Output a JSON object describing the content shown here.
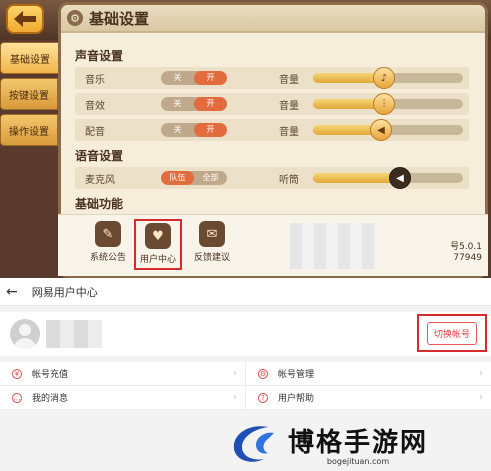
{
  "game": {
    "panel_title": "基础设置",
    "tabs": [
      "基础设置",
      "按键设置",
      "操作设置"
    ],
    "sections": {
      "sound": "声音设置",
      "voice": "语音设置",
      "basic": "基础功能"
    },
    "sound_rows": [
      {
        "label": "音乐",
        "off": "关",
        "on": "开",
        "vol_label": "音量",
        "level": 0.47,
        "icon": "music-note-icon"
      },
      {
        "label": "音效",
        "off": "关",
        "on": "开",
        "vol_label": "音量",
        "level": 0.47,
        "icon": "equalizer-icon"
      },
      {
        "label": "配音",
        "off": "关",
        "on": "开",
        "vol_label": "音量",
        "level": 0.45,
        "icon": "speaker-icon"
      }
    ],
    "voice_row": {
      "label": "麦克风",
      "opt1": "队伍",
      "opt2": "全部",
      "listen_label": "听筒",
      "level": 0.58
    },
    "bottom_items": [
      {
        "label": "系统公告",
        "icon": "announcement-icon"
      },
      {
        "label": "用户中心",
        "icon": "user-center-icon"
      },
      {
        "label": "反馈建议",
        "icon": "feedback-icon"
      }
    ],
    "version_text": "号5.0.1",
    "id_text": "77949"
  },
  "user_center": {
    "title": "网易用户中心",
    "switch_account": "切换帐号",
    "menu": [
      [
        {
          "label": "帐号充值",
          "icon": "recharge-icon"
        },
        {
          "label": "帐号管理",
          "icon": "gear-icon"
        }
      ],
      [
        {
          "label": "我的消息",
          "icon": "message-icon"
        },
        {
          "label": "用户帮助",
          "icon": "help-icon"
        }
      ]
    ]
  },
  "watermark": {
    "name": "博格手游网",
    "url": "bogejituan.com"
  },
  "colors": {
    "accent": "#e36c3f",
    "highlight": "#d62b2b",
    "panel": "#f6eedb"
  }
}
